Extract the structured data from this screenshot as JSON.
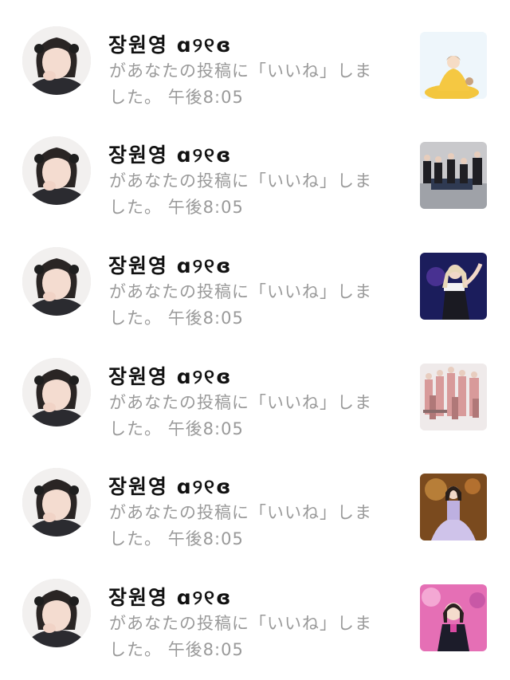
{
  "notifications": [
    {
      "username": "장원영 ɑ୨୧ɞ",
      "message_line1": "があなたの投稿に「いいね」しま",
      "message_line2": "した。",
      "time": "午後8:05",
      "thumbnail_icon": "cartoon-princess-thumbnail"
    },
    {
      "username": "장원영 ɑ୨୧ɞ",
      "message_line1": "があなたの投稿に「いいね」しま",
      "message_line2": "した。",
      "time": "午後8:05",
      "thumbnail_icon": "group-photo-thumbnail"
    },
    {
      "username": "장원영 ɑ୨୧ɞ",
      "message_line1": "があなたの投稿に「いいね」しま",
      "message_line2": "した。",
      "time": "午後8:05",
      "thumbnail_icon": "stage-performer-thumbnail"
    },
    {
      "username": "장원영 ɑ୨୧ɞ",
      "message_line1": "があなたの投稿に「いいね」しま",
      "message_line2": "した。",
      "time": "午後8:05",
      "thumbnail_icon": "group-poster-thumbnail"
    },
    {
      "username": "장원영 ɑ୨୧ɞ",
      "message_line1": "があなたの投稿に「いいね」しま",
      "message_line2": "した。",
      "time": "午後8:05",
      "thumbnail_icon": "dress-performer-thumbnail"
    },
    {
      "username": "장원영 ɑ୨୧ɞ",
      "message_line1": "があなたの投稿に「いいね」しま",
      "message_line2": "した。",
      "time": "午後8:05",
      "thumbnail_icon": "pink-stage-performer-thumbnail"
    }
  ]
}
